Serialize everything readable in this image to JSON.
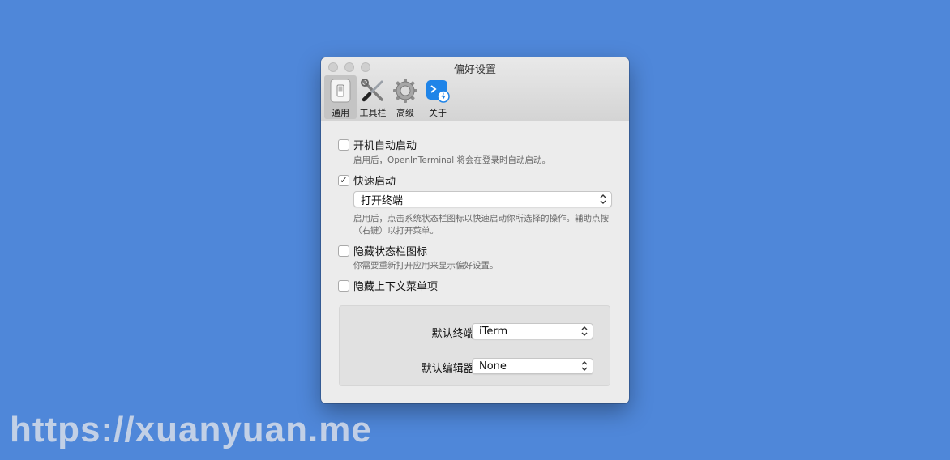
{
  "window": {
    "title": "偏好设置"
  },
  "toolbar": {
    "items": [
      {
        "label": "通用",
        "icon": "switch-icon",
        "active": true
      },
      {
        "label": "工具栏",
        "icon": "tools-icon"
      },
      {
        "label": "高级",
        "icon": "gear-icon"
      },
      {
        "label": "关于",
        "icon": "app-terminal-icon"
      }
    ]
  },
  "general": {
    "launch_at_login": {
      "label": "开机自动启动",
      "checked": false,
      "desc": "启用后，OpenInTerminal 将会在登录时自动启动。"
    },
    "quick_launch": {
      "label": "快速启动",
      "checked": true,
      "select_value": "打开终端",
      "desc": "启用后，点击系统状态栏图标以快速启动你所选择的操作。辅助点按（右键）以打开菜单。"
    },
    "hide_status_icon": {
      "label": "隐藏状态栏图标",
      "checked": false,
      "desc": "你需要重新打开应用来显示偏好设置。"
    },
    "hide_context_menu": {
      "label": "隐藏上下文菜单项",
      "checked": false
    }
  },
  "defaults": {
    "terminal_label": "默认终端:",
    "terminal_value": "iTerm",
    "editor_label": "默认编辑器:",
    "editor_value": "None"
  },
  "watermark": "https://xuanyuan.me",
  "colors": {
    "background": "#4f87d9",
    "window": "#ececec"
  }
}
